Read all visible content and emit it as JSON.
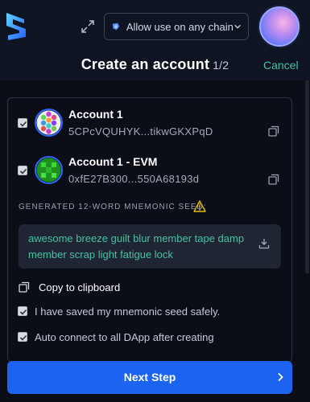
{
  "header": {
    "chain_select_label": "Allow use on any chain",
    "title": "Create an account",
    "step": "1/2",
    "cancel_label": "Cancel"
  },
  "accounts": [
    {
      "name": "Account 1",
      "address": "5CPcVQUHYK...tikwGKXPqD",
      "checked": true,
      "avatar": "polkadot-identicon"
    },
    {
      "name": "Account 1 - EVM",
      "address": "0xfE27B300...550A68193d",
      "checked": true,
      "avatar": "evm-identicon"
    }
  ],
  "seed": {
    "label": "GENERATED 12-WORD MNEMONIC SEED:",
    "phrase": "awesome breeze guilt blur member tape damp member scrap light fatigue lock"
  },
  "copy_label": "Copy to clipboard",
  "options": [
    {
      "label": "I have saved my mnemonic seed safely.",
      "checked": true
    },
    {
      "label": "Auto connect to all DApp after creating",
      "checked": true
    }
  ],
  "next_button_label": "Next Step",
  "colors": {
    "background": "#0b0d17",
    "header_bg": "#0e1422",
    "accent_green": "#43c2a1",
    "primary_blue": "#1c64f0",
    "warning": "#e6b800"
  },
  "icons": [
    "logo",
    "expand-icon",
    "chain-icon",
    "chevron-down-icon",
    "copy-icon",
    "warning-icon",
    "download-icon",
    "chevron-right-icon"
  ]
}
